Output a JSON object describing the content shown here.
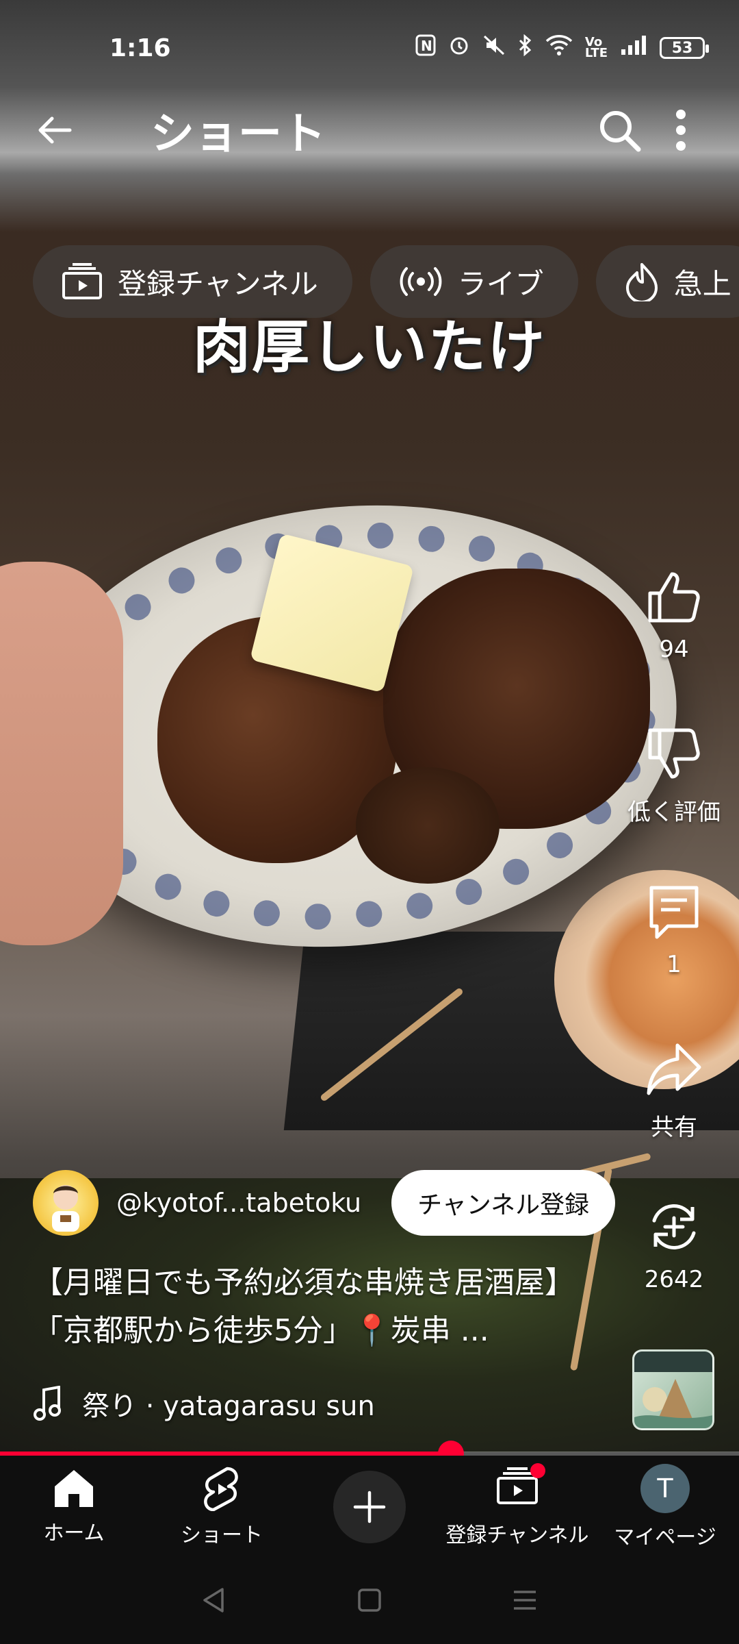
{
  "status_bar": {
    "time": "1:16",
    "battery": "53"
  },
  "header": {
    "title": "ショート"
  },
  "chips": [
    {
      "label": "登録チャンネル"
    },
    {
      "label": "ライブ"
    },
    {
      "label": "急上"
    }
  ],
  "video": {
    "caption": "肉厚しいたけ"
  },
  "actions": {
    "like_count": "94",
    "dislike_label": "低く評価",
    "comment_count": "1",
    "share_label": "共有",
    "remix_count": "2642"
  },
  "channel": {
    "name": "@kyotof...tabetoku",
    "subscribe_label": "チャンネル登録"
  },
  "video_title": "【月曜日でも予約必須な串焼き居酒屋】「京都駅から徒歩5分」📍炭串 ...",
  "music": {
    "label": "祭り · yatagarasu sun"
  },
  "progress": {
    "fraction": 0.61
  },
  "bottom_nav": [
    {
      "label": "ホーム"
    },
    {
      "label": "ショート"
    },
    {
      "label": ""
    },
    {
      "label": "登録チャンネル"
    },
    {
      "label": "マイページ",
      "avatar_letter": "T"
    }
  ],
  "colors": {
    "accent": "#ff0033",
    "nav_bg": "#0f0f0f"
  },
  "icons": [
    "back-arrow-icon",
    "search-icon",
    "more-vert-icon",
    "subscriptions-icon",
    "live-icon",
    "trending-icon",
    "like-icon",
    "dislike-icon",
    "comment-icon",
    "share-icon",
    "remix-icon",
    "music-note-icon",
    "home-icon",
    "shorts-icon",
    "plus-icon"
  ]
}
